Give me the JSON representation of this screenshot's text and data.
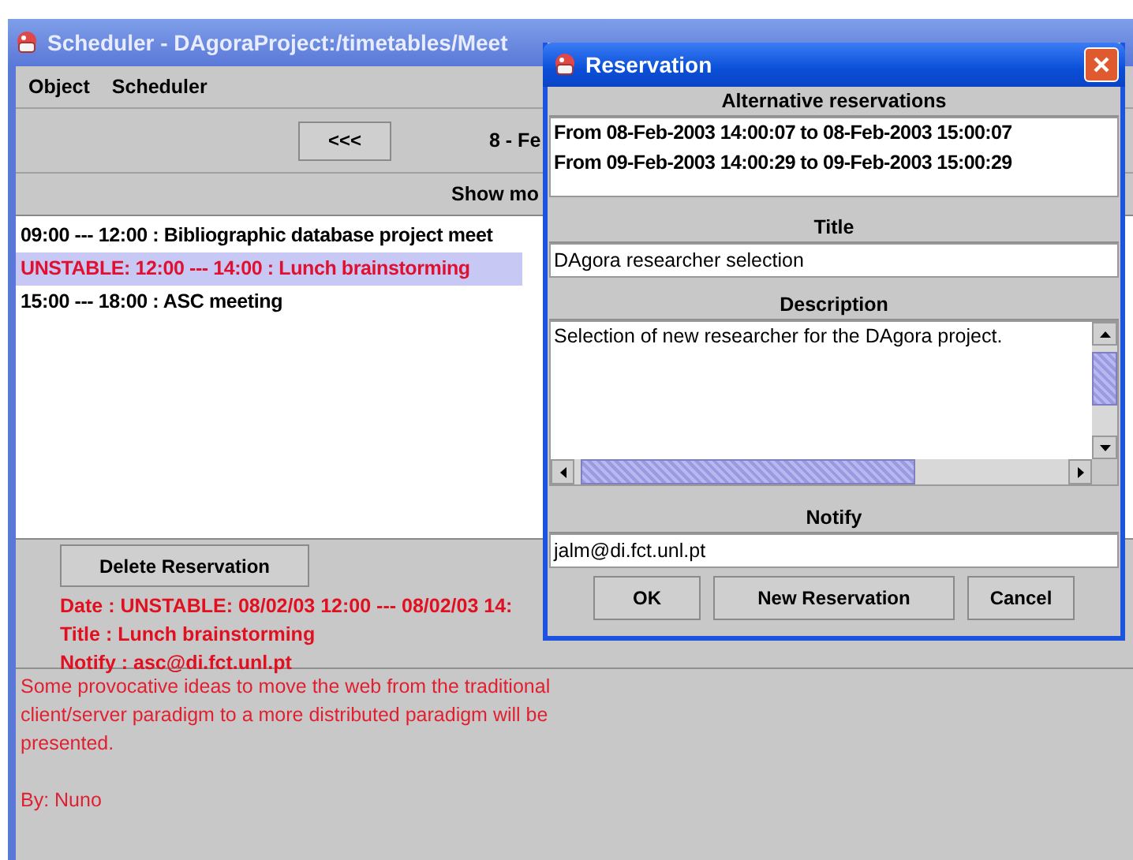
{
  "main_window": {
    "title": "Scheduler - DAgoraProject:/timetables/Meet",
    "menu": [
      "Object",
      "Scheduler"
    ],
    "prev_button": "<<<",
    "date_label": "8 - Fe",
    "show_more": "Show mo",
    "events": [
      {
        "text": "09:00 --- 12:00 : Bibliographic database project meet",
        "unstable": false,
        "selected": false
      },
      {
        "text": "UNSTABLE: 12:00 --- 14:00 : Lunch brainstorming",
        "unstable": true,
        "selected": true
      },
      {
        "text": "15:00 --- 18:00 : ASC meeting",
        "unstable": false,
        "selected": false
      }
    ],
    "delete_button": "Delete Reservation",
    "details": [
      "Date : UNSTABLE: 08/02/03 12:00 --- 08/02/03 14:",
      "Title : Lunch brainstorming",
      "Notify : asc@di.fct.unl.pt"
    ],
    "description": [
      "Some provocative ideas to move the web from the traditional client/server paradigm to a more distributed paradigm will be presented.",
      "By: Nuno"
    ]
  },
  "dialog": {
    "title": "Reservation",
    "alternatives_header": "Alternative reservations",
    "alternatives": [
      "From 08-Feb-2003 14:00:07 to 08-Feb-2003 15:00:07",
      "From 09-Feb-2003 14:00:29 to 09-Feb-2003 15:00:29"
    ],
    "title_label": "Title",
    "title_value": "DAgora researcher selection",
    "description_label": "Description",
    "description_value": "Selection of new researcher for the DAgora project.",
    "notify_label": "Notify",
    "notify_value": "jalm@di.fct.unl.pt",
    "buttons": [
      "OK",
      "New Reservation",
      "Cancel"
    ]
  }
}
